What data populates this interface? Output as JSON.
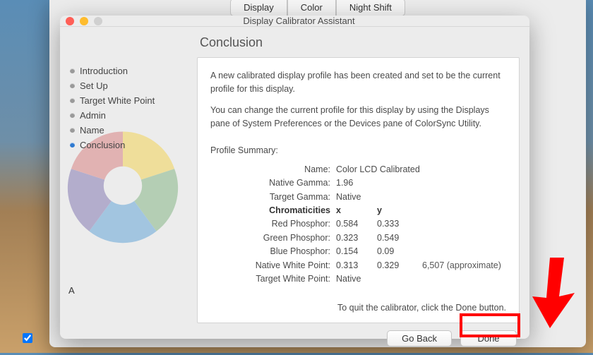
{
  "outer": {
    "tabs": [
      "Display",
      "Color",
      "Night Shift"
    ]
  },
  "window": {
    "title": "Display Calibrator Assistant"
  },
  "sidebar": {
    "items": [
      {
        "label": "Introduction",
        "active": false
      },
      {
        "label": "Set Up",
        "active": false
      },
      {
        "label": "Target White Point",
        "active": false
      },
      {
        "label": "Admin",
        "active": false
      },
      {
        "label": "Name",
        "active": false
      },
      {
        "label": "Conclusion",
        "active": true
      }
    ],
    "a_label": "A"
  },
  "main": {
    "page_title": "Conclusion",
    "intro1": "A new calibrated display profile has been created and set to be the current profile for this display.",
    "intro2": "You can change the current profile for this display by using the Displays pane of System Preferences or the Devices pane of ColorSync Utility.",
    "summary_title": "Profile Summary:",
    "rows": {
      "name_label": "Name:",
      "name_value": "Color LCD Calibrated",
      "native_gamma_label": "Native Gamma:",
      "native_gamma_value": "1.96",
      "target_gamma_label": "Target Gamma:",
      "target_gamma_value": "Native",
      "chroma_label": "Chromaticities",
      "x_head": "x",
      "y_head": "y",
      "red_label": "Red Phosphor:",
      "red_x": "0.584",
      "red_y": "0.333",
      "green_label": "Green Phosphor:",
      "green_x": "0.323",
      "green_y": "0.549",
      "blue_label": "Blue Phosphor:",
      "blue_x": "0.154",
      "blue_y": "0.09",
      "nwp_label": "Native White Point:",
      "nwp_x": "0.313",
      "nwp_y": "0.329",
      "nwp_note": "6,507 (approximate)",
      "twp_label": "Target White Point:",
      "twp_value": "Native"
    },
    "quit_line": "To quit the calibrator, click the Done button."
  },
  "buttons": {
    "back": "Go Back",
    "done": "Done"
  }
}
